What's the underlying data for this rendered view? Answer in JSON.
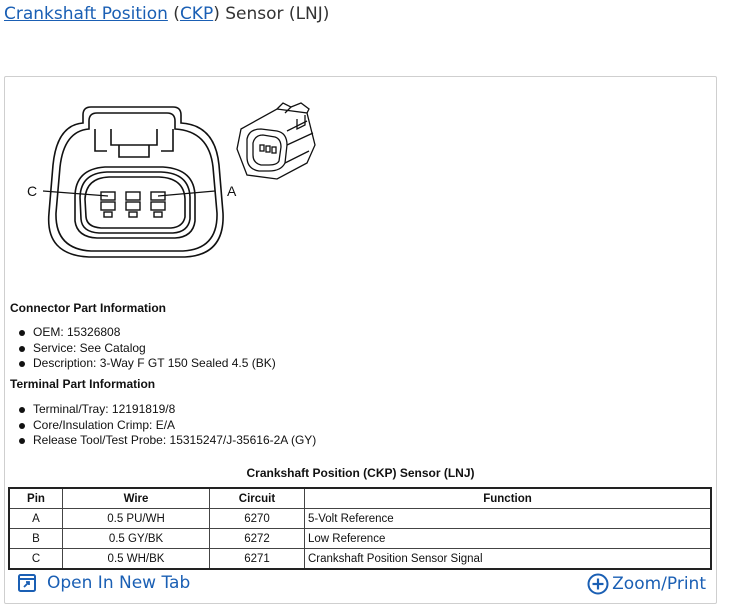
{
  "header": {
    "title_link1": "Crankshaft Position",
    "title_open": "(",
    "title_link2": "CKP",
    "title_rest": ") Sensor (LNJ)"
  },
  "diagram": {
    "label_left": "C",
    "label_right": "A"
  },
  "connector_info": {
    "heading": "Connector Part Information",
    "items": [
      "OEM: 15326808",
      "Service: See Catalog",
      "Description: 3-Way F GT 150 Sealed 4.5 (BK)"
    ]
  },
  "terminal_info": {
    "heading": "Terminal Part Information",
    "items": [
      "Terminal/Tray: 12191819/8",
      "Core/Insulation Crimp: E/A",
      "Release Tool/Test Probe: 15315247/J-35616-2A (GY)"
    ]
  },
  "pin_table": {
    "caption": "Crankshaft Position (CKP) Sensor (LNJ)",
    "headers": [
      "Pin",
      "Wire",
      "Circuit",
      "Function"
    ],
    "rows": [
      [
        "A",
        "0.5 PU/WH",
        "6270",
        "5-Volt Reference"
      ],
      [
        "B",
        "0.5 GY/BK",
        "6272",
        "Low Reference"
      ],
      [
        "C",
        "0.5 WH/BK",
        "6271",
        "Crankshaft Position Sensor Signal"
      ]
    ]
  },
  "footer": {
    "open_tab_label": "Open In New Tab",
    "zoom_print_label": "Zoom/Print",
    "open_tab_icon": "open-new-tab-icon",
    "zoom_icon": "zoom-plus-icon",
    "accent_color": "#1a5fb4"
  }
}
